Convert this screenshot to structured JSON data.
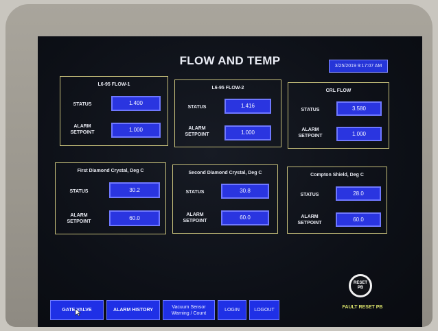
{
  "screen": {
    "title": "FLOW AND TEMP",
    "datetime": "3/25/2019 9:17:07 AM"
  },
  "panels": [
    {
      "title": "L6-95 FLOW-1",
      "status_label": "STATUS",
      "status": "1.400",
      "alarm_label_1": "ALARM",
      "alarm_label_2": "SETPOINT",
      "alarm": "1.000"
    },
    {
      "title": "L6-95 FLOW-2",
      "status_label": "STATUS",
      "status": "1.416",
      "alarm_label_1": "ALARM",
      "alarm_label_2": "SETPOINT",
      "alarm": "1.000"
    },
    {
      "title": "CRL FLOW",
      "status_label": "STATUS",
      "status": "3.580",
      "alarm_label_1": "ALARM",
      "alarm_label_2": "SETPOINT",
      "alarm": "1.000"
    },
    {
      "title": "First Diamond Crystal, Deg C",
      "status_label": "STATUS",
      "status": "30.2",
      "alarm_label_1": "ALARM",
      "alarm_label_2": "SETPOINT",
      "alarm": "60.0"
    },
    {
      "title": "Second Diamond Crystal, Deg C",
      "status_label": "STATUS",
      "status": "30.8",
      "alarm_label_1": "ALARM",
      "alarm_label_2": "SETPOINT",
      "alarm": "60.0"
    },
    {
      "title": "Compton Shield, Deg C",
      "status_label": "STATUS",
      "status": "28.0",
      "alarm_label_1": "ALARM",
      "alarm_label_2": "SETPOINT",
      "alarm": "60.0"
    }
  ],
  "buttons": {
    "gate_valve": "GATE VALVE",
    "alarm_history": "ALARM HISTORY",
    "vacuum_line1": "Vacuum Sensor",
    "vacuum_line2": "Warning / Count",
    "login": "LOGIN",
    "logout": "LOGOUT"
  },
  "reset": {
    "line1": "RESET",
    "line2": "PB",
    "label": "FAULT RESET PB"
  },
  "icons": {
    "pointer": "mouse-pointer-icon"
  },
  "colors": {
    "field_blue": "#2a35e0",
    "panel_border": "#c9c27c",
    "fault_label": "#d8e06a"
  }
}
